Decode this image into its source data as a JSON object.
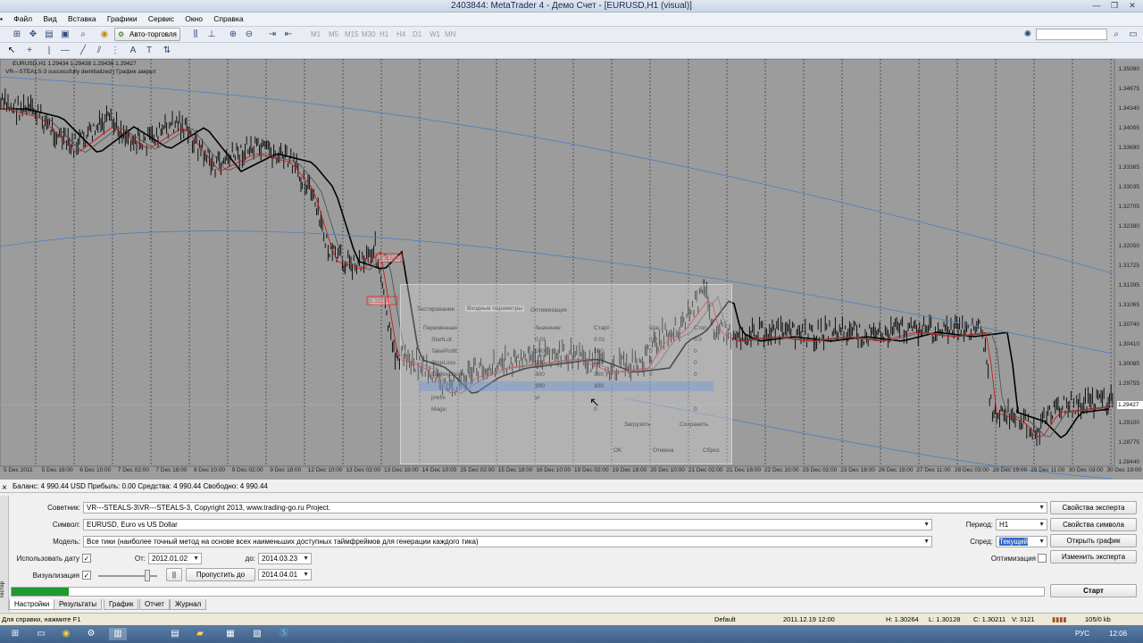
{
  "window": {
    "title": "2403844: MetaTrader 4 - Демо Счет - [EURUSD,H1 (visual)]",
    "minimize": "—",
    "restore": "❐",
    "close": "✕"
  },
  "menu": [
    "Файл",
    "Вид",
    "Вставка",
    "Графики",
    "Сервис",
    "Окно",
    "Справка"
  ],
  "toolbar": {
    "autotrading_label": "Авто-торговля",
    "timeframes": [
      "M1",
      "M5",
      "M15",
      "M30",
      "H1",
      "H4",
      "D1",
      "W1",
      "MN"
    ],
    "search_placeholder": ""
  },
  "chart": {
    "info_line1": "EURUSD,H1  1.29434 1.29438 1.29436 1.29427",
    "info_line2": "VR---STEALS-3 successfully deinitialized  |  График закрыт",
    "current_price": "1.29427",
    "price_levels": [
      "1.35080",
      "1.34675",
      "1.34340",
      "1.34005",
      "1.33690",
      "1.33365",
      "1.33035",
      "1.32705",
      "1.32380",
      "1.32050",
      "1.31725",
      "1.31395",
      "1.31065",
      "1.30740",
      "1.30410",
      "1.30085",
      "1.29755",
      "1.29100",
      "1.28775",
      "1.28440"
    ],
    "time_labels": [
      "5 Dec 2011",
      "5 Dec 18:00",
      "6 Dec 10:00",
      "7 Dec 02:00",
      "7 Dec 18:00",
      "8 Dec 10:00",
      "9 Dec 02:00",
      "9 Dec 18:00",
      "12 Dec 10:00",
      "13 Dec 02:00",
      "13 Dec 18:00",
      "14 Dec 10:00",
      "15 Dec 02:00",
      "15 Dec 18:00",
      "16 Dec 10:00",
      "19 Dec 02:00",
      "19 Dec 18:00",
      "20 Dec 10:00",
      "21 Dec 02:00",
      "21 Dec 18:00",
      "22 Dec 10:00",
      "23 Dec 02:00",
      "23 Dec 18:00",
      "26 Dec 19:00",
      "27 Dec 11:00",
      "28 Dec 03:00",
      "28 Dec 19:00",
      "29 Dec 11:00",
      "30 Dec 03:00",
      "30 Dec 19:00"
    ],
    "order_labels": [
      "1.31510",
      "1.31135"
    ]
  },
  "ghost_dialog": {
    "tabs": [
      "Тестирование",
      "Входные параметры",
      "Оптимизация"
    ],
    "headers": [
      "Переменная",
      "Значение",
      "Старт",
      "Шаг",
      "Стоп"
    ],
    "rows": [
      [
        "StartLot",
        "0.01",
        "0.01",
        "0.0",
        "0.0"
      ],
      [
        "TakeProfit",
        "500",
        "500",
        "0",
        "0"
      ],
      [
        "StopLoss",
        "500",
        "500",
        "0",
        "0"
      ],
      [
        "TrailingStop",
        "300",
        "300",
        "0",
        "0"
      ],
      [
        "",
        "300",
        "300",
        "",
        ""
      ],
      [
        "prefix",
        "vr",
        "",
        "",
        ""
      ],
      [
        "Magic",
        "",
        "0",
        "",
        "0"
      ]
    ],
    "buttons": [
      "Загрузить",
      "Сохранить",
      "OK",
      "Отмена",
      "Сброс"
    ]
  },
  "account_bar": "Баланс: 4 990.44 USD  Прибыль: 0.00  Средства: 4 990.44  Свободно: 4 990.44",
  "tester": {
    "expert_label": "Советник:",
    "expert_value": "VR---STEALS-3\\VR---STEALS-3, Copyright 2013, www.trading-go.ru Project.",
    "symbol_label": "Символ:",
    "symbol_value": "EURUSD, Euro vs US Dollar",
    "model_label": "Модель:",
    "model_value": "Все тики (наиболее точный метод на основе всех наименьших доступных таймфреймов для генерации каждого тика)",
    "use_date_label": "Использовать дату",
    "from_label": "От:",
    "from_value": "2012.01.02",
    "to_label": "до:",
    "to_value": "2014.03.23",
    "visual_label": "Визуализация",
    "pause_label": "||",
    "skip_label": "Пропустить до",
    "skip_value": "2014.04.01",
    "period_label": "Период:",
    "period_value": "H1",
    "spread_label": "Спред:",
    "spread_value": "Текущий",
    "optimization_label": "Оптимизация",
    "btn_expert_props": "Свойства эксперта",
    "btn_symbol_props": "Свойства символа",
    "btn_open_chart": "Открыть график",
    "btn_modify_expert": "Изменить эксперта",
    "btn_start": "Старт",
    "progress": 0.055,
    "side_label": "Тестер"
  },
  "tabs": [
    "Настройки",
    "Результаты",
    "График",
    "Отчет",
    "Журнал"
  ],
  "status": {
    "help": "Для справки, нажмите F1",
    "profile": "Default",
    "datetime": "2011.12.19 12:00",
    "high": "H: 1.30264",
    "low": "L: 1.30128",
    "close": "C: 1.30211",
    "volume": "V: 3121",
    "traffic": "105/0 kb"
  },
  "taskbar": {
    "lang": "РУС",
    "time": "12:06"
  }
}
